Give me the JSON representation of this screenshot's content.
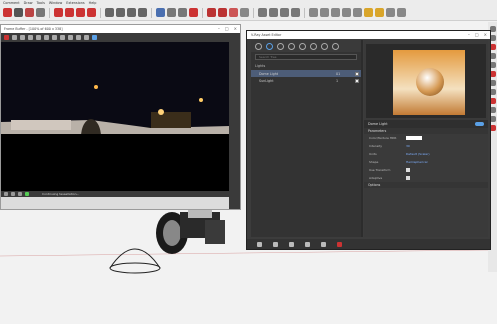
{
  "menu": [
    "Comment",
    "Draw",
    "Tools",
    "Window",
    "Extensions",
    "Help"
  ],
  "frame_buffer": {
    "title": "Frame Buffer - [100% of 600 x 338]",
    "status": "Continuing tessellation..."
  },
  "asset_editor": {
    "title": "V-Ray Asset Editor",
    "search_placeholder": "Search Tree",
    "section": "Lights",
    "lights": [
      {
        "name": "Dome Light",
        "count": "01"
      },
      {
        "name": "SunLight",
        "count": "1"
      }
    ],
    "panel_title": "Dome Light",
    "parameters_label": "Parameters",
    "props": [
      {
        "label": "Color/Texture HDR",
        "kind": "swatch"
      },
      {
        "label": "Intensity",
        "value": "30"
      },
      {
        "label": "Units",
        "value": "Default (Scalar)"
      }
    ],
    "shape_label": "Shape",
    "shape_value": "Hemispherical",
    "use_transform_label": "Use Transform",
    "adaptive_label": "Adaptive",
    "options_label": "Options"
  },
  "colors": {
    "accent": "#5aa0e6",
    "panel_bg": "#3a3a3a",
    "selection": "#4d5d78"
  }
}
